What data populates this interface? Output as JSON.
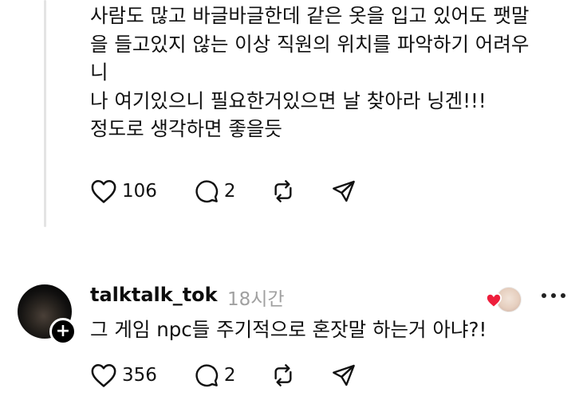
{
  "post": {
    "lines": [
      "사람도 많고 바글바글한데 같은 옷을 입고 있어도 팻말",
      "을 들고있지 않는 이상 직원의 위치를 파악하기 어려우",
      "니",
      "나 여기있으니 필요한거있으면 날 찾아라 닝겐!!!",
      "정도로 생각하면 좋을듯"
    ],
    "likes": "106",
    "replies": "2"
  },
  "reply": {
    "username": "talktalk_tok",
    "timestamp": "18시간",
    "text": "그 게임 npc들 주기적으로 혼잣말 하는거 아냐?!",
    "likes": "356",
    "replies": "2",
    "follow_symbol": "+"
  },
  "icons": {
    "like": "heart-outline-icon",
    "reply": "speech-bubble-icon",
    "repost": "repost-icon",
    "share": "paper-plane-icon",
    "liked_badge": "red-heart-icon",
    "more": "more-dots-icon"
  },
  "colors": {
    "text": "#101010",
    "timestamp": "#a0a0a0",
    "like_red": "#ee1e3c",
    "thread_line": "#e4e4e4"
  }
}
